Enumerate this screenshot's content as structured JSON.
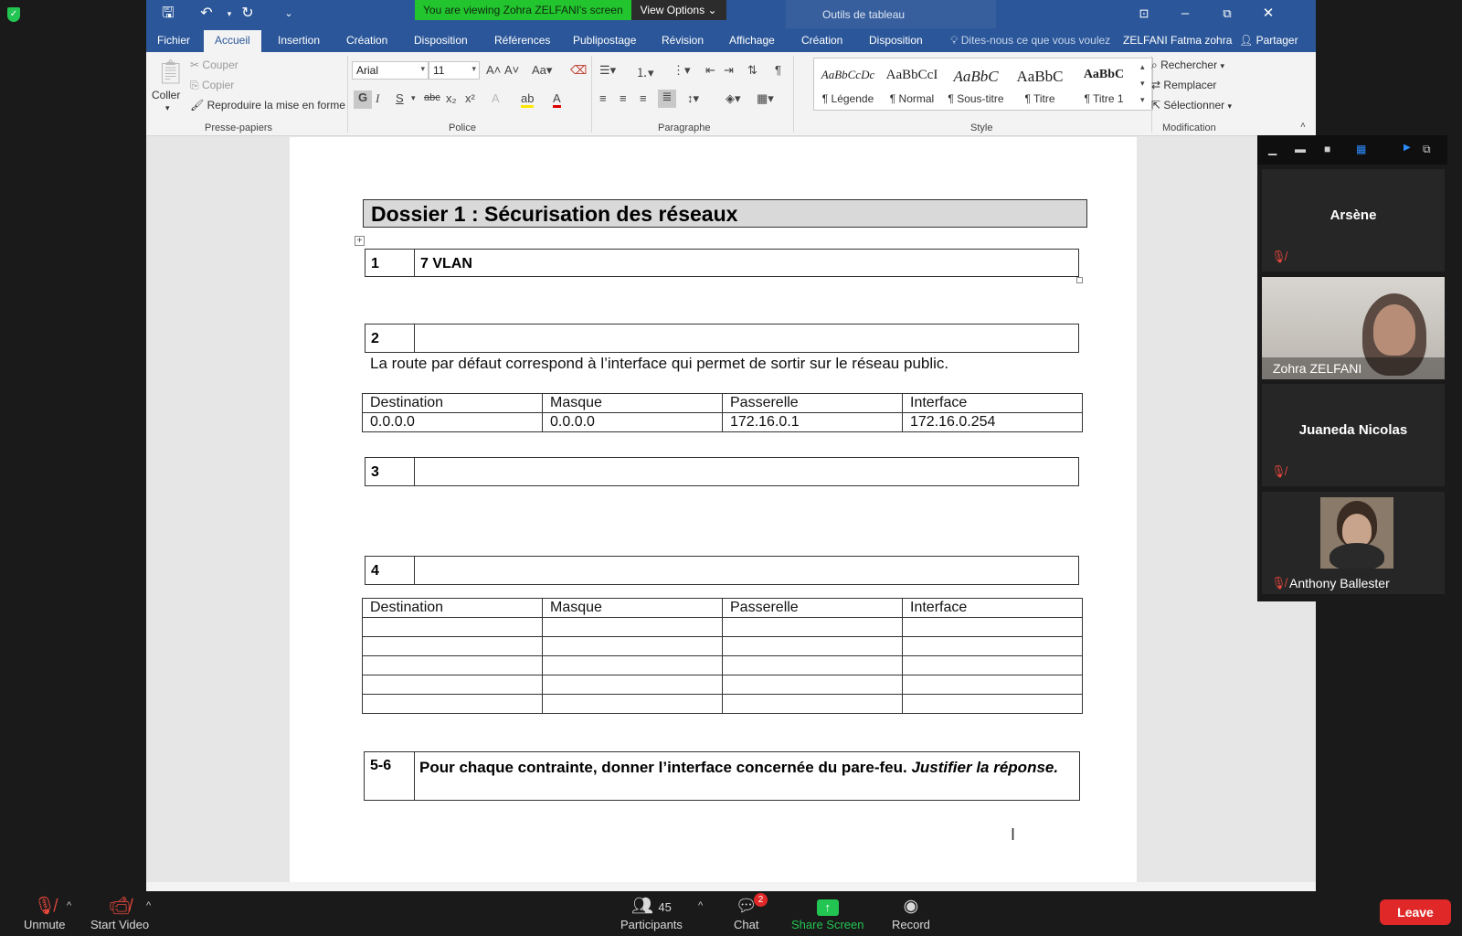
{
  "banner": {
    "text": "You are viewing Zohra  ZELFANI's screen",
    "view_options": "View Options"
  },
  "word": {
    "tools_label": "Outils de tableau",
    "tabs": [
      "Fichier",
      "Accueil",
      "Insertion",
      "Création",
      "Disposition",
      "Références",
      "Publipostage",
      "Révision",
      "Affichage",
      "Création",
      "Disposition"
    ],
    "tellme": "Dites-nous ce que vous voulez",
    "user": "ZELFANI Fatma zohra",
    "share": "Partager",
    "clipboard": {
      "paste": "Coller",
      "cut": "Couper",
      "copy": "Copier",
      "format_painter": "Reproduire la mise en forme",
      "label": "Presse-papiers"
    },
    "font": {
      "name": "Arial",
      "size": "11",
      "label": "Police"
    },
    "paragraph_label": "Paragraphe",
    "styles": {
      "label": "Style",
      "items": [
        {
          "sample": "AaBbCcDc",
          "name": "¶ Légende"
        },
        {
          "sample": "AaBbCcI",
          "name": "¶ Normal"
        },
        {
          "sample": "AaBbC",
          "name": "¶ Sous-titre"
        },
        {
          "sample": "AaBbC",
          "name": "¶ Titre"
        },
        {
          "sample": "AaBbC",
          "name": "¶ Titre 1"
        }
      ]
    },
    "editing": {
      "find": "Rechercher",
      "replace": "Remplacer",
      "select": "Sélectionner",
      "label": "Modification"
    }
  },
  "document": {
    "title": "Dossier 1 : Sécurisation des réseaux",
    "q1": {
      "num": "1",
      "text": "7  VLAN"
    },
    "q2": {
      "num": "2",
      "text": ""
    },
    "route_text": "La route par défaut correspond à l’interface qui permet de sortir sur le réseau public.",
    "table1": {
      "headers": [
        "Destination",
        "Masque",
        "Passerelle",
        "Interface"
      ],
      "rows": [
        [
          "0.0.0.0",
          "0.0.0.0",
          "172.16.0.1",
          "172.16.0.254"
        ]
      ]
    },
    "q3": {
      "num": "3",
      "text": ""
    },
    "q4": {
      "num": "4",
      "text": ""
    },
    "table2": {
      "headers": [
        "Destination",
        "Masque",
        "Passerelle",
        "Interface"
      ],
      "rows": [
        [
          "",
          "",
          "",
          ""
        ],
        [
          "",
          "",
          "",
          ""
        ],
        [
          "",
          "",
          "",
          ""
        ],
        [
          "",
          "",
          "",
          ""
        ],
        [
          "",
          "",
          "",
          ""
        ]
      ]
    },
    "q56": {
      "num": "5-6",
      "text": "Pour chaque contrainte, donner l’interface concernée du pare-feu.",
      "emph": "Justifier la réponse."
    }
  },
  "participants_panel": [
    {
      "name": "Arsène",
      "muted": true,
      "video": false
    },
    {
      "name": "Zohra  ZELFANI",
      "muted": false,
      "video": true
    },
    {
      "name": "Juaneda Nicolas",
      "muted": true,
      "video": false
    },
    {
      "name": "Anthony Ballester",
      "muted": true,
      "video": false,
      "avatar": true
    }
  ],
  "zoom_bar": {
    "unmute": "Unmute",
    "start_video": "Start Video",
    "participants": "Participants",
    "participants_count": "45",
    "chat": "Chat",
    "chat_badge": "2",
    "share_screen": "Share Screen",
    "record": "Record",
    "leave": "Leave"
  },
  "colors": {
    "word_blue": "#2b579a",
    "banner_green": "#23c52e",
    "leave_red": "#e02828",
    "share_green": "#23c552"
  }
}
